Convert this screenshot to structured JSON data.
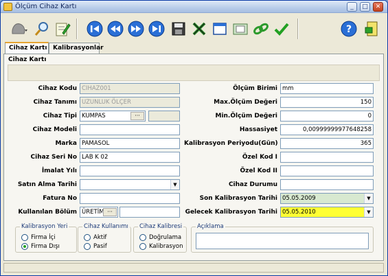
{
  "window": {
    "title": "Ölçüm Cihaz Kartı",
    "min": "_",
    "max": "□",
    "close": "✕"
  },
  "tabs": [
    {
      "label": "Cihaz Kartı",
      "active": true
    },
    {
      "label": "Kalibrasyonlar",
      "active": false
    }
  ],
  "card": {
    "title": "Cihaz Kartı"
  },
  "form": {
    "cihaz_kodu": {
      "label": "Cihaz Kodu",
      "value": "CIHAZ001"
    },
    "cihaz_tanimi": {
      "label": "Cihaz Tanımı",
      "value": "UZUNLUK ÖLÇER"
    },
    "cihaz_tipi": {
      "label": "Cihaz Tipi",
      "value": "KUMPAS",
      "btn": "···"
    },
    "cihaz_modeli": {
      "label": "Cihaz Modeli",
      "value": ""
    },
    "marka": {
      "label": "Marka",
      "value": "PAMASOL"
    },
    "cihaz_seri_no": {
      "label": "Cihaz Seri No",
      "value": "LAB K 02"
    },
    "imalat_yili": {
      "label": "İmalat Yılı",
      "value": ""
    },
    "satin_alma_tarihi": {
      "label": "Satın Alma Tarihi",
      "value": ""
    },
    "fatura_no": {
      "label": "Fatura No",
      "value": ""
    },
    "kullanilan_bolum": {
      "label": "Kullanılan Bölüm",
      "value": "ÜRETİM",
      "btn": "···"
    },
    "olcum_birimi": {
      "label": "Ölçüm Birimi",
      "value": "mm"
    },
    "max_olcum": {
      "label": "Max.Ölçüm Değeri",
      "value": "150"
    },
    "min_olcum": {
      "label": "Min.Ölçüm Değeri",
      "value": "0"
    },
    "hassasiyet": {
      "label": "Hassasiyet",
      "value": "0,00999999977648258"
    },
    "kalibrasyon_periyodu": {
      "label": "Kalibrasyon Periyodu(Gün)",
      "value": "365"
    },
    "ozel_kod_1": {
      "label": "Özel Kod I",
      "value": ""
    },
    "ozel_kod_2": {
      "label": "Özel Kod II",
      "value": ""
    },
    "cihaz_durumu": {
      "label": "Cihaz Durumu",
      "value": ""
    },
    "son_kalibrasyon": {
      "label": "Son Kalibrasyon Tarihi",
      "value": "05.05.2009"
    },
    "gelecek_kalibrasyon": {
      "label": "Gelecek Kalibrasyon Tarihi",
      "value": "05.05.2010"
    }
  },
  "groups": {
    "kalibrasyon_yeri": {
      "title": "Kalibrasyon Yeri",
      "options": [
        "Firma İçi",
        "Firma Dışı"
      ],
      "selected": 1
    },
    "cihaz_kullanimi": {
      "title": "Cihaz Kullanımı",
      "options": [
        "Aktif",
        "Pasif"
      ],
      "selected": -1
    },
    "cihaz_kalibresi": {
      "title": "Cihaz Kalibresi",
      "options": [
        "Doğrulama",
        "Kalibrasyon"
      ],
      "selected": -1
    },
    "aciklama": {
      "title": "Açıklama",
      "value": ""
    }
  },
  "colors": {
    "green_field": "#d8e9d0",
    "yellow_field": "#ffff33",
    "active_tab_accent": "#e6a431"
  },
  "toolbar_icons": [
    "gray-blob-icon",
    "magnify-icon",
    "note-edit-icon",
    "first-record-icon",
    "prev-record-icon",
    "next-record-icon",
    "last-record-icon",
    "save-disk-icon",
    "cancel-x-icon",
    "window-icon",
    "print-preview-icon",
    "link-icon",
    "confirm-check-icon",
    "help-icon",
    "exit-door-icon"
  ]
}
